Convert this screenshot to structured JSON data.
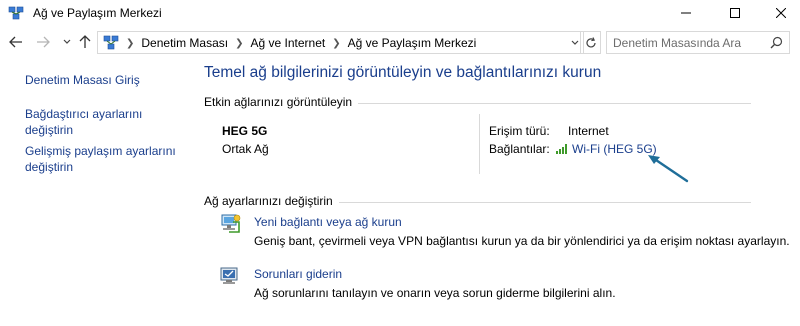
{
  "window": {
    "title": "Ağ ve Paylaşım Merkezi"
  },
  "address": {
    "breadcrumbs": [
      "Denetim Masası",
      "Ağ ve Internet",
      "Ağ ve Paylaşım Merkezi"
    ],
    "search_placeholder": "Denetim Masasında Ara"
  },
  "sidebar": {
    "items": [
      {
        "label": "Denetim Masası Giriş"
      },
      {
        "label": "Bağdaştırıcı ayarlarını değiştirin"
      },
      {
        "label": "Gelişmiş paylaşım ayarlarını değiştirin"
      }
    ]
  },
  "main": {
    "heading": "Temel ağ bilgilerinizi görüntüleyin ve bağlantılarınızı kurun",
    "active_networks": {
      "section_title": "Etkin ağlarınızı görüntüleyin",
      "network_name": "HEG 5G",
      "network_type": "Ortak Ağ",
      "access_type_label": "Erişim türü:",
      "access_type_value": "Internet",
      "connections_label": "Bağlantılar:",
      "connection_link": "Wi-Fi (HEG 5G)"
    },
    "change_settings": {
      "section_title": "Ağ ayarlarınızı değiştirin",
      "tasks": [
        {
          "link": "Yeni bağlantı veya ağ kurun",
          "description": "Geniş bant, çevirmeli veya VPN bağlantısı kurun ya da bir yönlendirici ya da erişim noktası ayarlayın.",
          "icon": "network-setup-icon"
        },
        {
          "link": "Sorunları giderin",
          "description": "Ağ sorunlarını tanılayın ve onarın veya sorun giderme bilgilerini alın.",
          "icon": "troubleshoot-icon"
        }
      ]
    }
  },
  "colors": {
    "link": "#1a3e8c",
    "annotation_arrow": "#1f6e99",
    "divider": "#d9d9d9"
  }
}
